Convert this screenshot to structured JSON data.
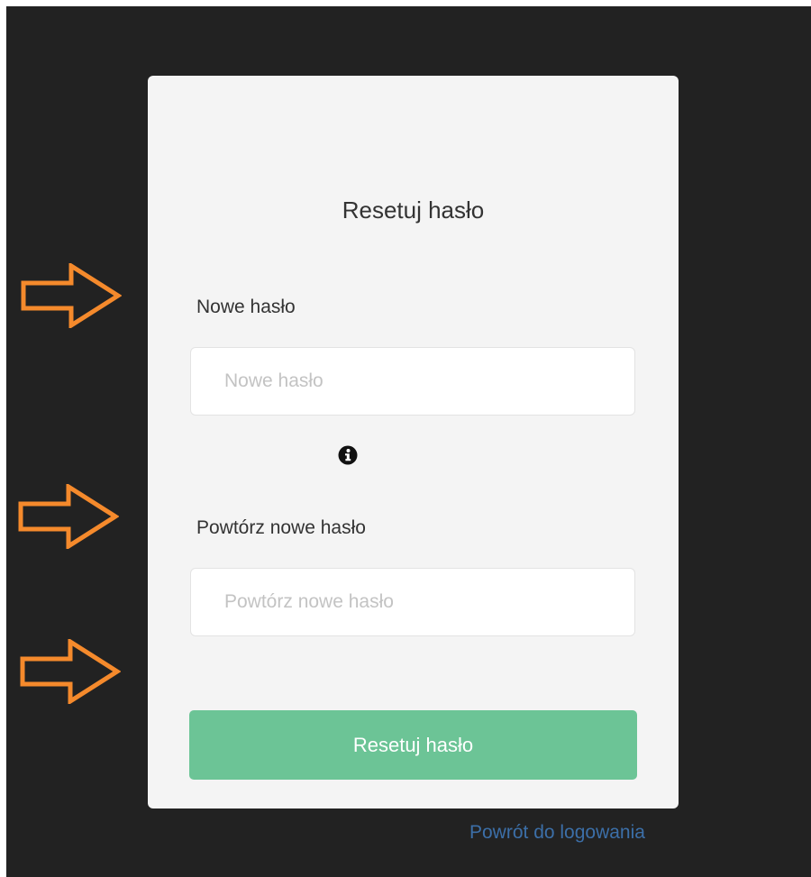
{
  "form": {
    "title": "Resetuj hasło",
    "new_password": {
      "label": "Nowe hasło",
      "placeholder": "Nowe hasło",
      "value": ""
    },
    "info_icon": "info-circle-icon",
    "repeat_password": {
      "label": "Powtórz nowe hasło",
      "placeholder": "Powtórz nowe hasło",
      "value": ""
    },
    "submit_label": "Resetuj hasło",
    "back_link": "Powrót do logowania"
  },
  "annotations": {
    "icon": "arrow-right-outline-icon",
    "count": 3
  },
  "colors": {
    "backdrop": "#222222",
    "card": "#f4f4f4",
    "button": "#6cc496",
    "link": "#3c6fa8",
    "annotation_arrow": "#f58a2c"
  }
}
